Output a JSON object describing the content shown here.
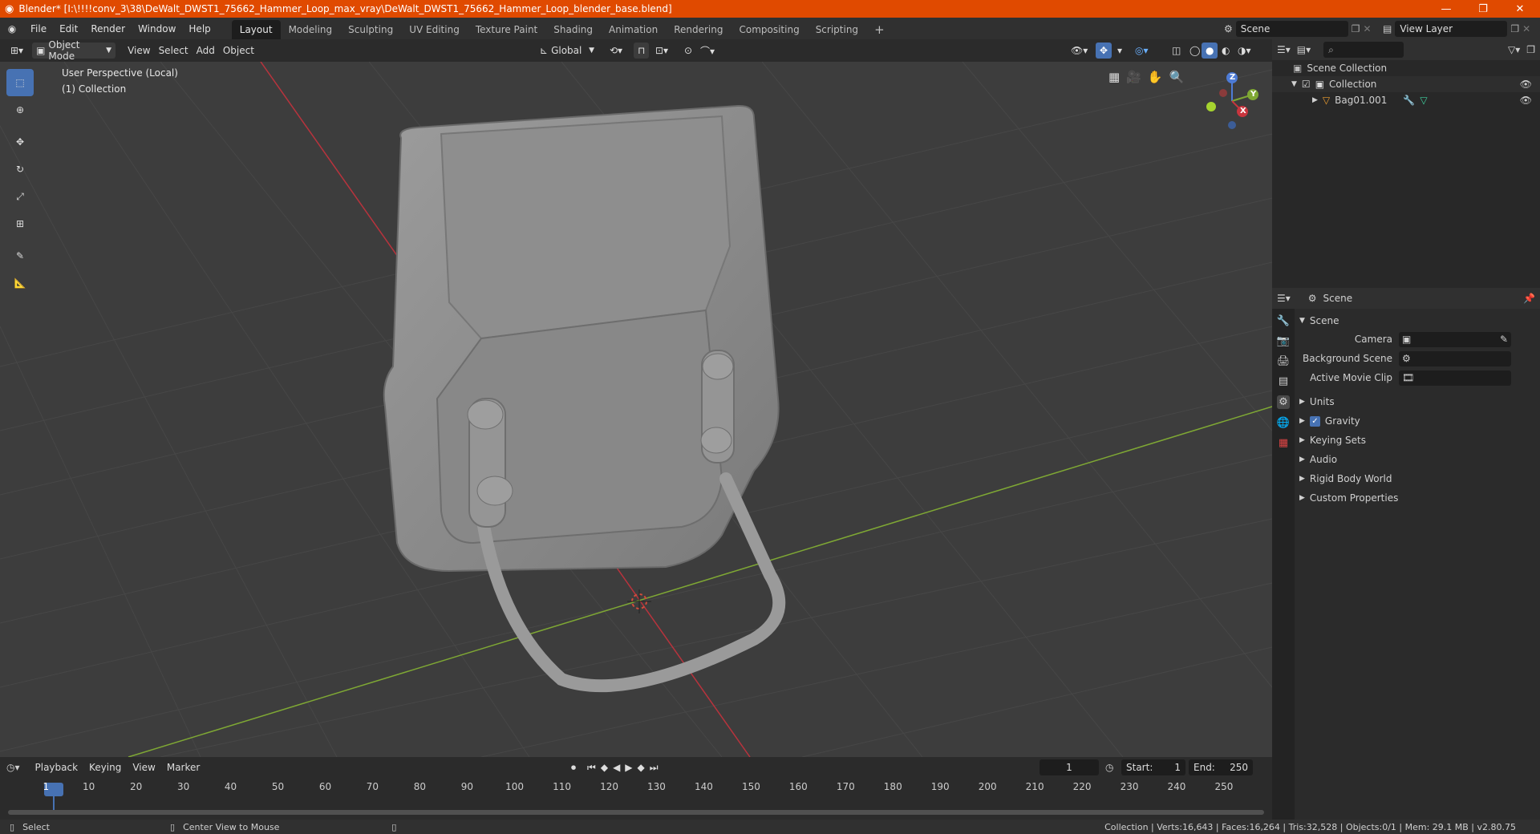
{
  "titlebar": {
    "title": "Blender* [I:\\!!!!conv_3\\38\\DeWalt_DWST1_75662_Hammer_Loop_max_vray\\DeWalt_DWST1_75662_Hammer_Loop_blender_base.blend]",
    "minimize": "—",
    "maximize": "❐",
    "close": "✕"
  },
  "menubar": {
    "items": [
      "File",
      "Edit",
      "Render",
      "Window",
      "Help"
    ]
  },
  "workspaces": {
    "tabs": [
      "Layout",
      "Modeling",
      "Sculpting",
      "UV Editing",
      "Texture Paint",
      "Shading",
      "Animation",
      "Rendering",
      "Compositing",
      "Scripting"
    ],
    "active": "Layout",
    "add": "+"
  },
  "scene_selector": {
    "value": "Scene"
  },
  "viewlayer_selector": {
    "value": "View Layer"
  },
  "viewport_header": {
    "mode": "Object Mode",
    "menus": [
      "View",
      "Select",
      "Add",
      "Object"
    ],
    "orientation": "Global"
  },
  "viewport": {
    "perspective_label": "User Perspective (Local)",
    "collection_label": "(1) Collection",
    "gizmo": {
      "z": "Z",
      "y": "Y",
      "x": "X"
    }
  },
  "outliner": {
    "root": "Scene Collection",
    "collection": "Collection",
    "object": "Bag01.001"
  },
  "properties": {
    "context": "Scene",
    "panel_title": "Scene",
    "fields": {
      "camera": "Camera",
      "background_scene": "Background Scene",
      "active_movie_clip": "Active Movie Clip"
    },
    "subpanels": [
      "Units",
      "Gravity",
      "Keying Sets",
      "Audio",
      "Rigid Body World",
      "Custom Properties"
    ],
    "gravity_checked": true
  },
  "timeline": {
    "menus": [
      "Playback",
      "Keying",
      "View",
      "Marker"
    ],
    "current_frame": "1",
    "start_label": "Start:",
    "start": "1",
    "end_label": "End:",
    "end": "250",
    "ticks": [
      "1",
      "10",
      "20",
      "30",
      "40",
      "50",
      "60",
      "70",
      "80",
      "90",
      "100",
      "110",
      "120",
      "130",
      "140",
      "150",
      "160",
      "170",
      "180",
      "190",
      "200",
      "210",
      "220",
      "230",
      "240",
      "250"
    ]
  },
  "statusbar": {
    "select": "Select",
    "center_view": "Center View to Mouse",
    "stats": "Collection | Verts:16,643 | Faces:16,264 | Tris:32,528 | Objects:0/1 | Mem: 29.1 MB | v2.80.75"
  },
  "colors": {
    "titlebar": "#e04a00",
    "accent": "#4772b3",
    "x_axis": "#c8353e",
    "y_axis": "#7fa834"
  }
}
